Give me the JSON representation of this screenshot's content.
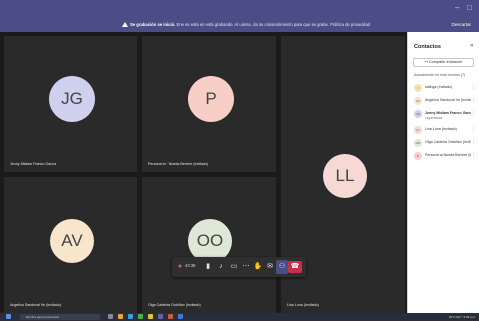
{
  "window": {
    "minimize": "–",
    "maximize": "□"
  },
  "banner": {
    "bold_text": "Se grabación se inició.",
    "text": " Ene se está en está grabando. Al unirse, da su consentimiento para que se grabe. Política de privacidad",
    "dismiss_label": "Descartar"
  },
  "tiles": [
    {
      "initials": "JG",
      "name": "Jenny Midiam Franco García",
      "color": "#cfd0ee"
    },
    {
      "initials": "P",
      "name": "Personería · Nueda Berrere (Invitado)",
      "color": "#f7cfc6"
    },
    {
      "initials": "LL",
      "name": "Lina Luna (Invitado)",
      "color": "#f6d9d4"
    },
    {
      "initials": "AV",
      "name": "Angelica Sandoval Ve (Invitado)",
      "color": "#f7e5cc"
    },
    {
      "initials": "OO",
      "name": "Olga Caldeira Ordóñez (Invitado)",
      "color": "#dfe8d6"
    }
  ],
  "controls": {
    "timer": "43:36",
    "video_icon": "video-camera-icon",
    "mic_icon": "microphone-icon",
    "share_icon": "share-screen-icon",
    "more_icon": "more-icon",
    "hand_icon": "raise-hand-icon",
    "chat_icon": "chat-icon",
    "people_icon": "people-icon",
    "hangup_icon": "hang-up-icon",
    "hangup_color": "#c4314b"
  },
  "panel": {
    "title": "Contactos",
    "close_icon": "close-icon",
    "invite_label": "Compartir invitación",
    "section_label": "Actualmente en esta reunión (7)",
    "people": [
      {
        "initials": "I",
        "name": "salinga (Invitado)",
        "sub": "",
        "color": "#f7e1b5"
      },
      {
        "initials": "AV",
        "name": "Angelica Sandoval Ve (Invitado)",
        "sub": "",
        "color": "#f7e5cc"
      },
      {
        "initials": "JG",
        "name": "Jenny Midiam Franco García",
        "sub": "Organizador",
        "color": "#cfd0ee"
      },
      {
        "initials": "LL",
        "name": "Lina Luna (Invitado)",
        "sub": "",
        "color": "#f6d9d4"
      },
      {
        "initials": "OO",
        "name": "Olga Caldeira Ordóñez (Invit)",
        "sub": "",
        "color": "#dfe8d6"
      },
      {
        "initials": "P",
        "name": "Personería Nueda Berrere (In",
        "sub": "",
        "color": "#f7cfc6"
      }
    ]
  },
  "taskbar": {
    "search_placeholder": "Escriba aquí para buscar",
    "tray_text": "29°C  ES  ^  4:36 p.m."
  }
}
